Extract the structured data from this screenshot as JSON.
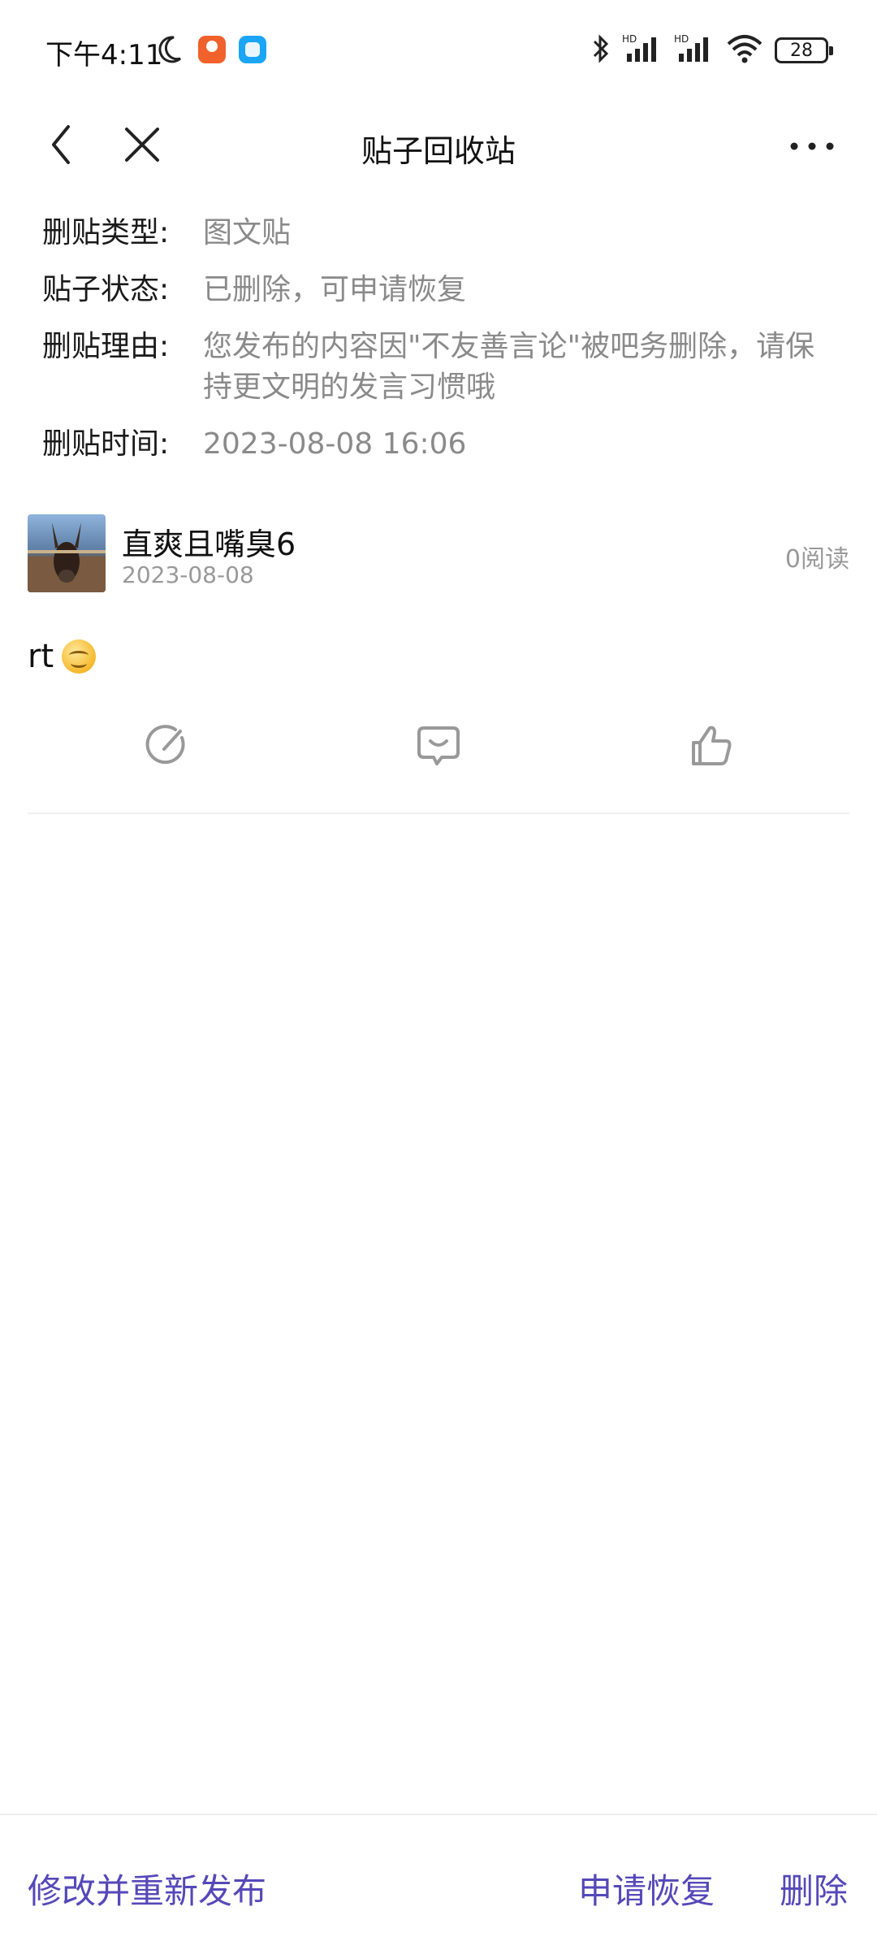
{
  "status_bar": {
    "time": "下午4:11",
    "signal_label_1": "HD",
    "signal_label_2": "HD",
    "battery": "28"
  },
  "nav": {
    "title": "贴子回收站",
    "icons": [
      "back-icon",
      "close-icon",
      "more-icon"
    ]
  },
  "info": {
    "type_label": "删贴类型:",
    "type_value": "图文贴",
    "status_label": "贴子状态:",
    "status_value": "已删除，可申请恢复",
    "reason_label": "删贴理由:",
    "reason_value": "您发布的内容因\"不友善言论\"被吧务删除，请保持更文明的发言习惯哦",
    "time_label": "删贴时间:",
    "time_value": "2023-08-08 16:06"
  },
  "post": {
    "username": "直爽且嘴臭6",
    "date": "2023-08-08",
    "reads": "0阅读",
    "content": "rt",
    "emoji": "smile-emoji"
  },
  "bottom": {
    "republish": "修改并重新发布",
    "restore": "申请恢复",
    "delete": "删除"
  },
  "colors": {
    "accent": "#5548b8",
    "secondary_text": "#8a8a8a",
    "divider": "#efefef"
  }
}
